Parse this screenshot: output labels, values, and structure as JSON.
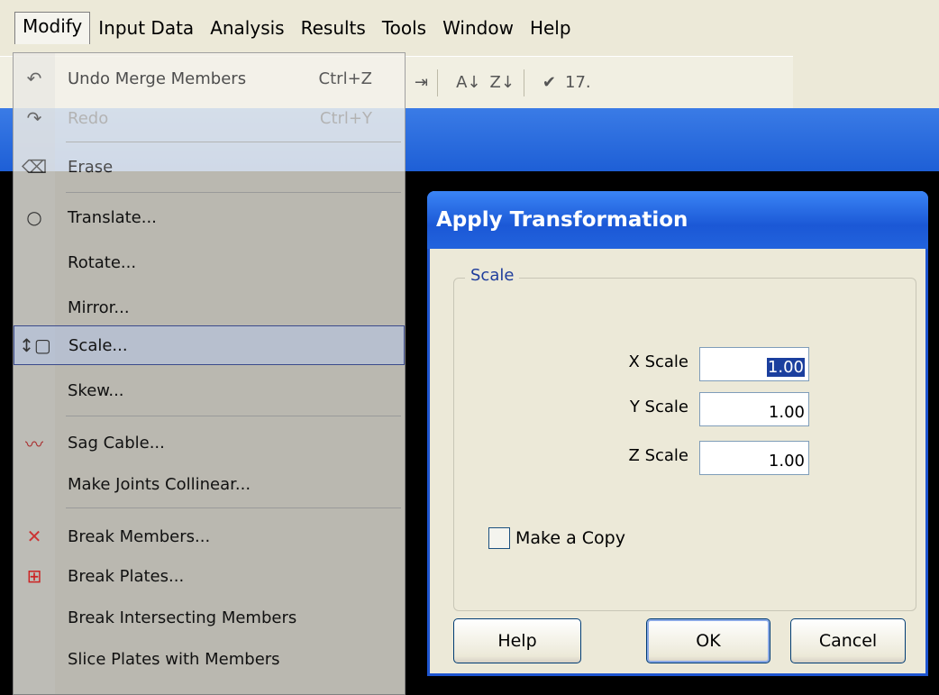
{
  "menubar": {
    "items": [
      {
        "label": "Modify",
        "mnemonic_index": -1
      },
      {
        "label": "Input Data"
      },
      {
        "label": "Analysis"
      },
      {
        "label": "Results"
      },
      {
        "label": "Tools"
      },
      {
        "label": "Window"
      },
      {
        "label": "Help"
      }
    ]
  },
  "toolbar": {
    "zoom_value": "17."
  },
  "menu": {
    "items": [
      {
        "label": "Undo Merge Members",
        "shortcut": "Ctrl+Z",
        "icon": "undo-icon",
        "state": "enabled"
      },
      {
        "label": "Redo",
        "shortcut": "Ctrl+Y",
        "icon": "redo-icon",
        "state": "disabled"
      },
      {
        "label": "Erase",
        "shortcut": "",
        "icon": "eraser-icon",
        "state": "enabled"
      },
      {
        "label": "Translate...",
        "shortcut": "",
        "icon": "translate-icon",
        "state": "enabled"
      },
      {
        "label": "Rotate...",
        "shortcut": "",
        "icon": "",
        "state": "enabled"
      },
      {
        "label": "Mirror...",
        "shortcut": "",
        "icon": "",
        "state": "enabled"
      },
      {
        "label": "Scale...",
        "shortcut": "",
        "icon": "scale-icon",
        "state": "highlighted"
      },
      {
        "label": "Skew...",
        "shortcut": "",
        "icon": "",
        "state": "enabled"
      },
      {
        "label": "Sag Cable...",
        "shortcut": "",
        "icon": "cable-icon",
        "state": "enabled"
      },
      {
        "label": "Make Joints Collinear...",
        "shortcut": "",
        "icon": "",
        "state": "enabled"
      },
      {
        "label": "Break Members...",
        "shortcut": "",
        "icon": "break-members-icon",
        "state": "enabled"
      },
      {
        "label": "Break Plates...",
        "shortcut": "",
        "icon": "break-plates-icon",
        "state": "enabled"
      },
      {
        "label": "Break Intersecting Members",
        "shortcut": "",
        "icon": "",
        "state": "enabled"
      },
      {
        "label": "Slice Plates with Members",
        "shortcut": "",
        "icon": "",
        "state": "enabled"
      }
    ]
  },
  "dialog": {
    "title": "Apply Transformation",
    "group_label": "Scale",
    "fields": [
      {
        "label": "X Scale",
        "value": "1.00",
        "selected": true
      },
      {
        "label": "Y Scale",
        "value": "1.00",
        "selected": false
      },
      {
        "label": "Z Scale",
        "value": "1.00",
        "selected": false
      }
    ],
    "checkbox_label": "Make a Copy",
    "checkbox_checked": false,
    "buttons": {
      "help": "Help",
      "ok": "OK",
      "cancel": "Cancel"
    }
  },
  "colors": {
    "title_bar": "#1b58d6",
    "group_label": "#1f3d9c",
    "selection": "#1b3f9e"
  }
}
